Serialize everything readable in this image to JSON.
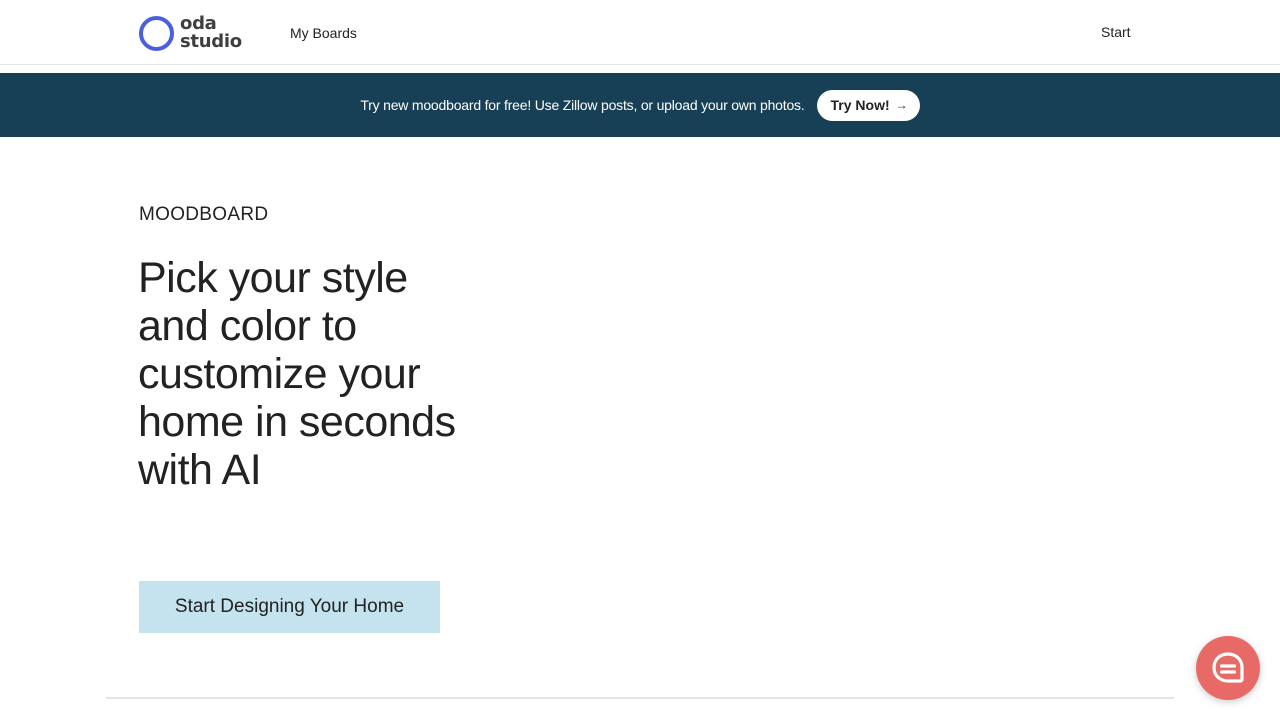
{
  "brand": {
    "line1": "oda",
    "line2": "studio",
    "ring_color": "#4a5fe0"
  },
  "nav": {
    "my_boards": "My Boards",
    "start": "Start"
  },
  "banner": {
    "text": "Try new moodboard for free! Use Zillow posts, or upload your own photos.",
    "button_label": "Try Now!",
    "button_icon": "arrow-right-icon",
    "background": "#173f55"
  },
  "hero": {
    "eyebrow": "MOODBOARD",
    "headline": "Pick your style and color to customize your home in seconds with AI",
    "cta_label": "Start Designing Your Home",
    "cta_color": "#c4e3ef"
  },
  "chat": {
    "icon": "chat-bubble-icon",
    "color": "#e86a66"
  }
}
